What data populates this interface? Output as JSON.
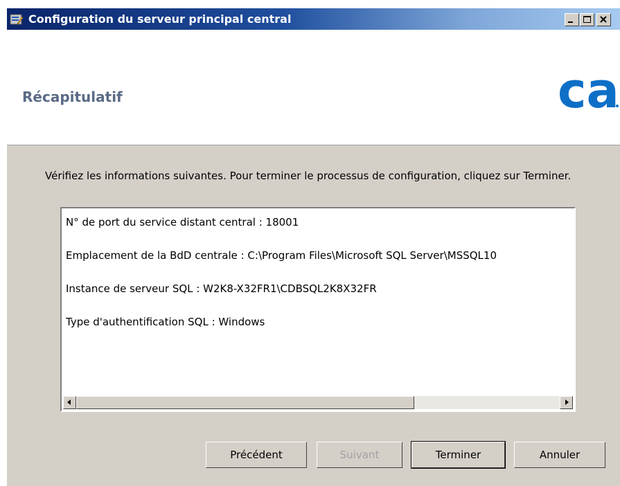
{
  "window": {
    "title": "Configuration du serveur principal central"
  },
  "header": {
    "title": "Récapitulatif",
    "logo_text": "ca"
  },
  "instructions": "Vérifiez les informations suivantes. Pour terminer le processus de configuration, cliquez sur Terminer.",
  "summary": {
    "items": [
      "N° de port du service distant central : 18001",
      "Emplacement de la BdD centrale : C:\\Program Files\\Microsoft SQL Server\\MSSQL10",
      "Instance de serveur SQL : W2K8-X32FR1\\CDBSQL2K8X32FR",
      "Type d'authentification SQL : Windows"
    ]
  },
  "buttons": {
    "previous": "Précédent",
    "next": "Suivant",
    "finish": "Terminer",
    "cancel": "Annuler"
  },
  "colors": {
    "header_title": "#5a6a86",
    "logo_blue": "#0e6fc7"
  }
}
